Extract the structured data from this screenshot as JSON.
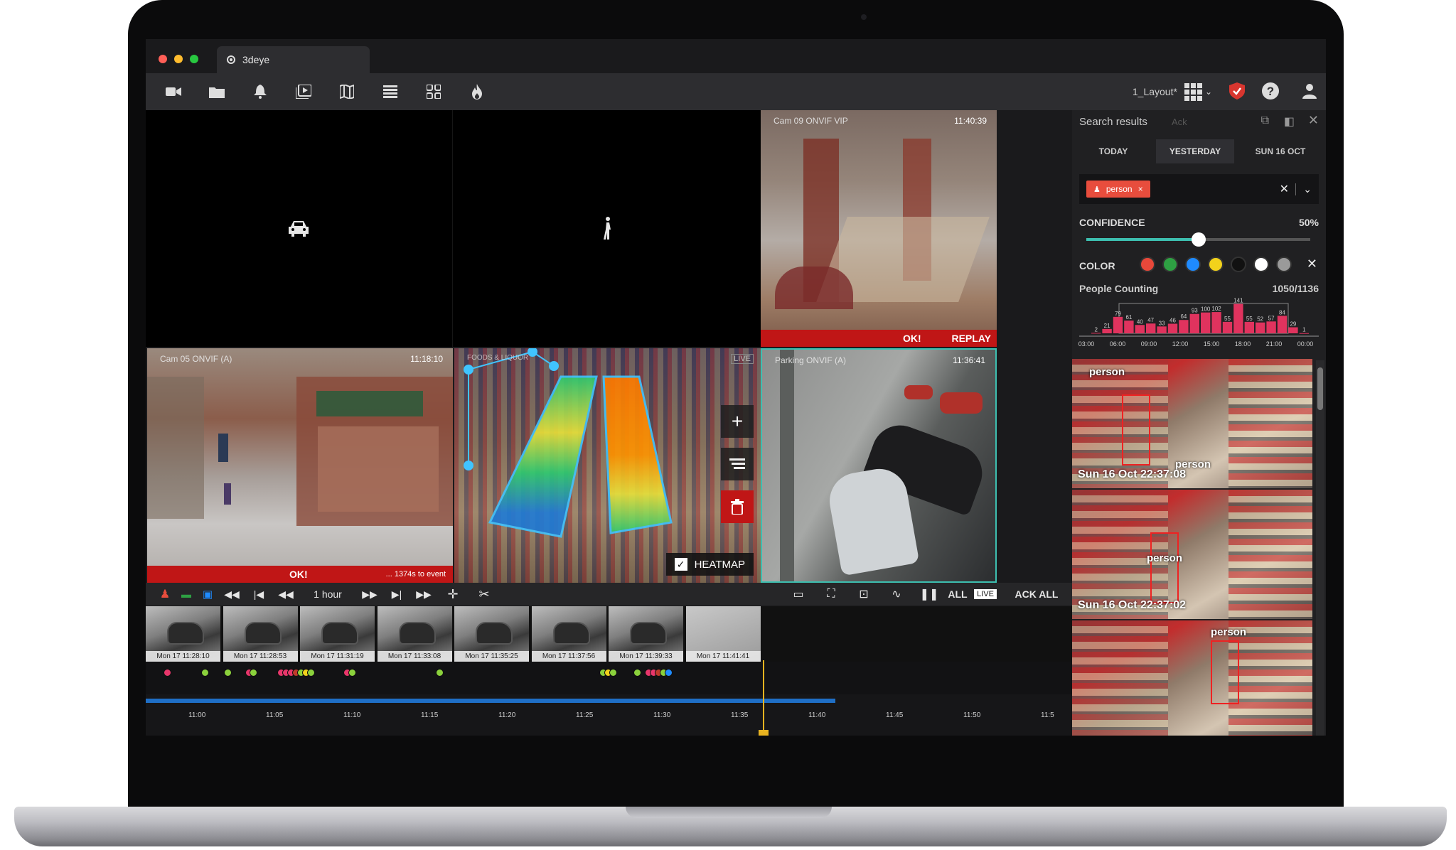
{
  "browser": {
    "tab_title": "3deye",
    "traffic_lights": [
      "#ff5f57",
      "#febc2e",
      "#28c840"
    ]
  },
  "toolbar": {
    "icons": [
      "video-camera-icon",
      "folder-icon",
      "bell-icon",
      "playlist-icon",
      "map-icon",
      "list-icon",
      "grid-icon",
      "fire-icon"
    ],
    "layout_name": "1_Layout*"
  },
  "cells": {
    "top_left": {
      "icon": "car-icon"
    },
    "top_middle": {
      "icon": "person-walking-icon"
    },
    "top_right": {
      "label": "Cam 09 ONVIF VIP",
      "time": "11:40:39",
      "status": "OK!",
      "action": "REPLAY"
    },
    "mid_left": {
      "label": "Cam 05 ONVIF (A)",
      "time": "11:18:10",
      "status": "OK!",
      "note": "... 1374s to event"
    },
    "mid_middle": {
      "label": "FOODS & LIQUOR",
      "badge": "LIVE",
      "heatmap_label": "HEATMAP"
    },
    "mid_right": {
      "label": "Parking ONVIF (A)",
      "time": "11:36:41"
    }
  },
  "controls": {
    "range": "1 hour",
    "all": "ALL",
    "live": "LIVE",
    "ack_all": "ACK ALL"
  },
  "thumbnails": [
    "Mon 17 11:28:10",
    "Mon 17 11:28:53",
    "Mon 17 11:31:19",
    "Mon 17 11:33:08",
    "Mon 17 11:35:25",
    "Mon 17 11:37:56",
    "Mon 17 11:39:33",
    "Mon 17 11:41:41"
  ],
  "timeline_ticks": [
    "11:00",
    "11:05",
    "11:10",
    "11:15",
    "11:20",
    "11:25",
    "11:30",
    "11:35",
    "11:40",
    "11:45",
    "11:50",
    "11:5"
  ],
  "panel": {
    "title": "Search results",
    "ack": "Ack",
    "date_tabs": [
      "TODAY",
      "YESTERDAY",
      "SUN 16 OCT"
    ],
    "filter_chip": "person",
    "confidence_label": "CONFIDENCE",
    "confidence_value": "50%",
    "color_label": "COLOR",
    "colors": [
      "#e8483a",
      "#2ea043",
      "#1f8bff",
      "#f2d21b",
      "#111111",
      "#ffffff",
      "#9a9a9a"
    ],
    "people_counting_label": "People Counting",
    "people_counting_value": "1050/1136",
    "results": [
      {
        "tag": "person",
        "timestamp": "Sun 16 Oct 22:37:08",
        "tag2": "person"
      },
      {
        "tag": "person",
        "timestamp": "Sun 16 Oct 22:37:02"
      },
      {
        "tag": "person"
      }
    ]
  },
  "chart_data": {
    "type": "bar",
    "categories": [
      "03:00",
      "06:00",
      "09:00",
      "12:00",
      "15:00",
      "18:00",
      "21:00",
      "00:00"
    ],
    "values": [
      2,
      21,
      79,
      61,
      40,
      47,
      33,
      46,
      64,
      93,
      100,
      102,
      55,
      141,
      55,
      52,
      57,
      84,
      29,
      1
    ],
    "value_labels": [
      "2",
      "21",
      "79",
      "61",
      "40",
      "47",
      "33",
      "46",
      "64",
      "93",
      "100",
      "102",
      "55",
      "141",
      "55",
      "52",
      "57",
      "84",
      "29",
      "1"
    ],
    "ylim": [
      0,
      150
    ]
  }
}
